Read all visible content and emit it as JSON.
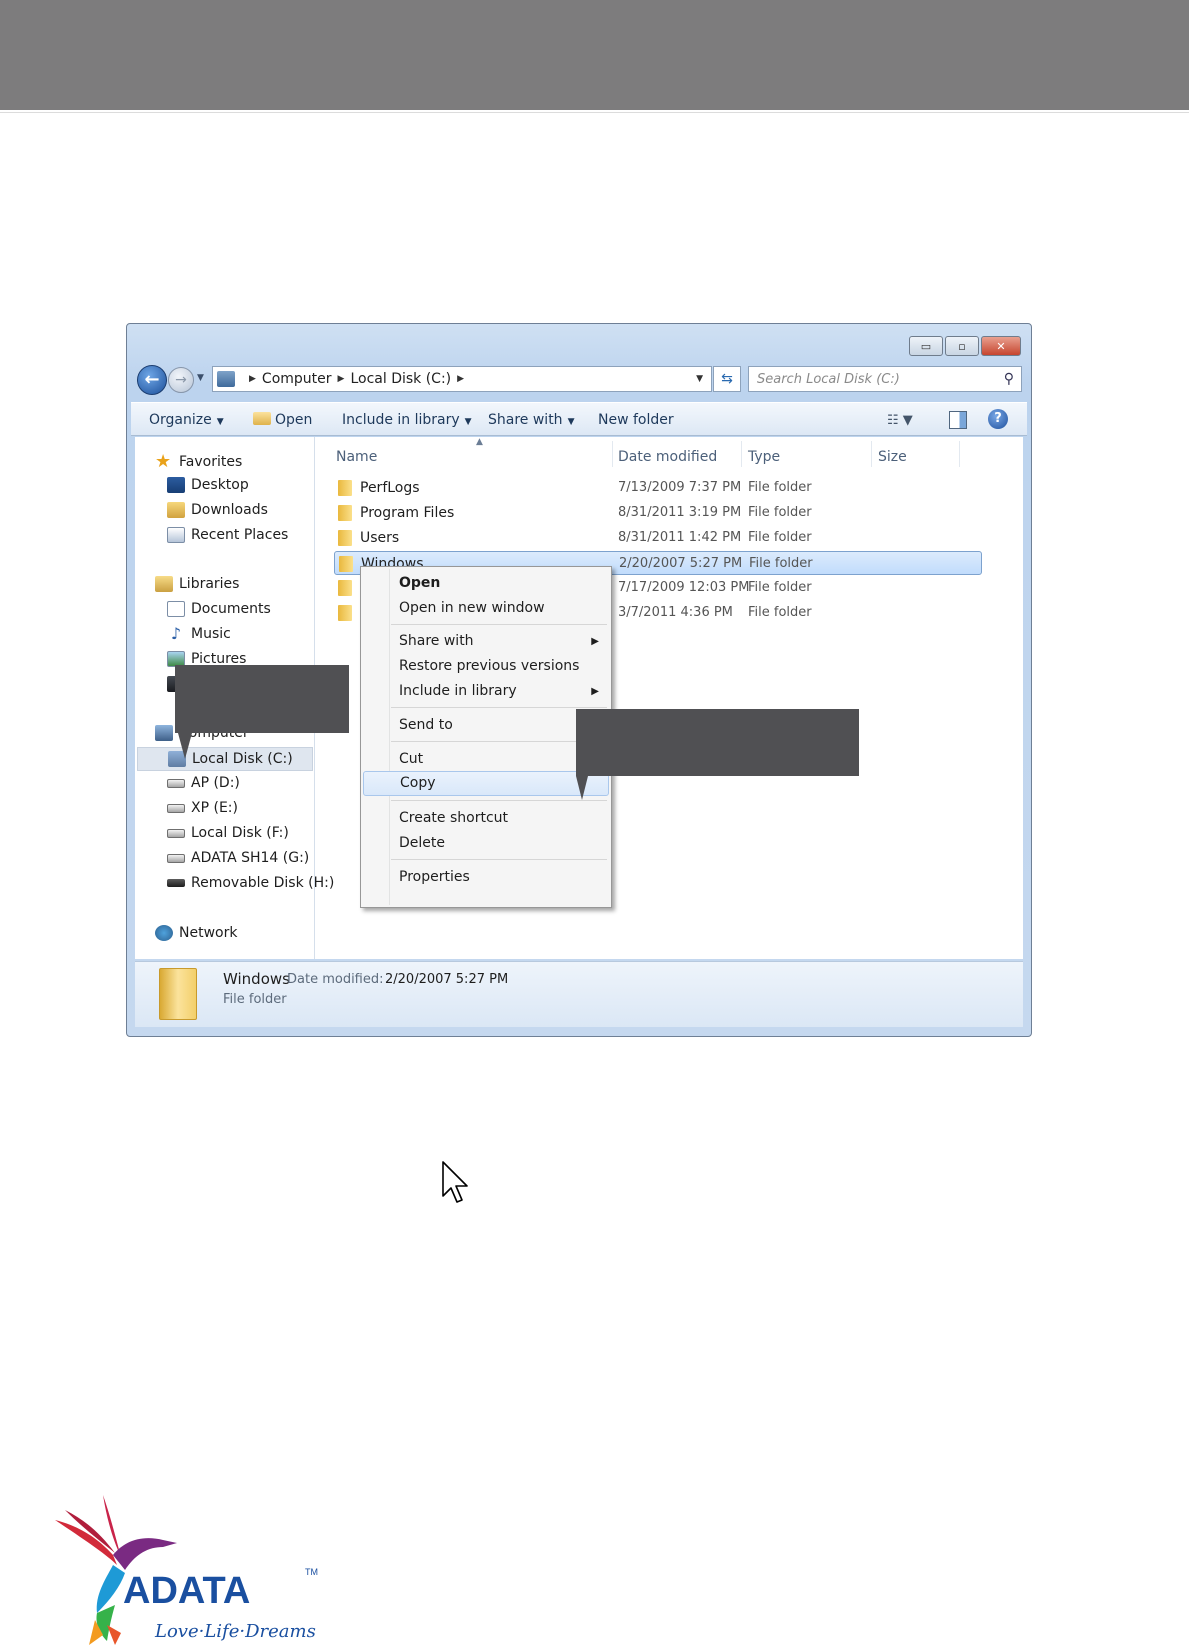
{
  "window": {
    "buttons": {
      "minimize": "▭",
      "maximize": "▫",
      "close": "✕"
    }
  },
  "address": {
    "crumbs": [
      "Computer",
      "Local Disk (C:)"
    ],
    "search_placeholder": "Search Local Disk (C:)"
  },
  "toolbar": {
    "organize": "Organize",
    "open": "Open",
    "include_in_library": "Include in library",
    "share_with": "Share with",
    "new_folder": "New folder"
  },
  "navpane": {
    "favorites": {
      "label": "Favorites",
      "items": [
        "Desktop",
        "Downloads",
        "Recent Places"
      ]
    },
    "libraries": {
      "label": "Libraries",
      "items": [
        "Documents",
        "Music",
        "Pictures"
      ]
    },
    "computer": {
      "label": "Computer",
      "items": [
        "Local Disk (C:)",
        "AP (D:)",
        "XP (E:)",
        "Local Disk (F:)",
        "ADATA SH14 (G:)",
        "Removable Disk (H:)"
      ]
    },
    "network": {
      "label": "Network"
    }
  },
  "columns": {
    "name": "Name",
    "date_modified": "Date modified",
    "type": "Type",
    "size": "Size"
  },
  "files": [
    {
      "name": "PerfLogs",
      "date": "7/13/2009 7:37 PM",
      "type": "File folder"
    },
    {
      "name": "Program Files",
      "date": "8/31/2011 3:19 PM",
      "type": "File folder"
    },
    {
      "name": "Users",
      "date": "8/31/2011 1:42 PM",
      "type": "File folder"
    },
    {
      "name": "Windows",
      "date": "2/20/2007 5:27 PM",
      "type": "File folder"
    },
    {
      "name": "",
      "date": "7/17/2009 12:03 PM",
      "type": "File folder"
    },
    {
      "name": "",
      "date": "3/7/2011 4:36 PM",
      "type": "File folder"
    }
  ],
  "details": {
    "name": "Windows",
    "date_modified_label": "Date modified:",
    "date_modified_value": "2/20/2007 5:27 PM",
    "type": "File folder"
  },
  "context_menu": {
    "open": "Open",
    "open_new_window": "Open in new window",
    "share_with": "Share with",
    "restore_previous": "Restore previous versions",
    "include_in_library": "Include in library",
    "send_to": "Send to",
    "cut": "Cut",
    "copy": "Copy",
    "create_shortcut": "Create shortcut",
    "delete": "Delete",
    "properties": "Properties"
  },
  "logo": {
    "brand": "ADATA",
    "tagline": "Love·Life·Dreams",
    "tm": "TM"
  },
  "colors": {
    "header_bar": "#7d7c7d",
    "callout": "#505053",
    "selection": "#c1dcfc",
    "logo_blue": "#1a4fa0"
  }
}
